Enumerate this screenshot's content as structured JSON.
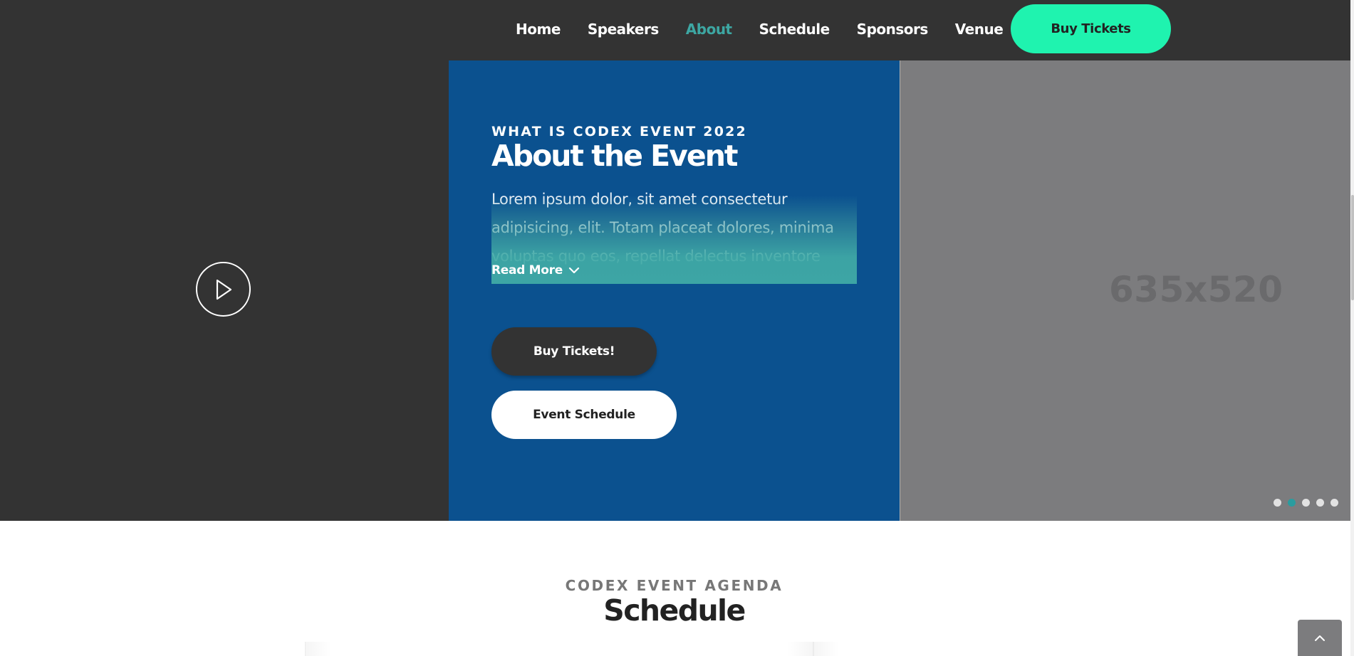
{
  "nav": {
    "items": [
      {
        "label": "Home",
        "active": false
      },
      {
        "label": "Speakers",
        "active": false
      },
      {
        "label": "About",
        "active": true
      },
      {
        "label": "Schedule",
        "active": false
      },
      {
        "label": "Sponsors",
        "active": false
      },
      {
        "label": "Venue",
        "active": false
      }
    ],
    "cta_label": "Buy Tickets"
  },
  "hero": {
    "play_icon": "play-icon",
    "eyebrow": "WHAT IS CODEX EVENT 2022",
    "title": "About the Event",
    "body": "Lorem ipsum dolor, sit amet consectetur adipisicing, elit. Totam placeat dolores, minima voluptas quo eos, repellat delectus inventore",
    "read_more_label": "Read More",
    "read_more_icon": "chevron-down-icon",
    "primary_button_label": "Buy Tickets!",
    "secondary_button_label": "Event Schedule",
    "image_placeholder_label": "635x520",
    "carousel": {
      "count": 5,
      "active_index": 1
    }
  },
  "schedule": {
    "eyebrow": "CODEX EVENT AGENDA",
    "title": "Schedule"
  },
  "scroll_top_icon": "chevron-up-icon",
  "colors": {
    "dark": "#333333",
    "accent_nav": "#3da7a3",
    "cta_green": "#1ff3af",
    "panel_blue": "#0b518f",
    "placeholder_gray": "#7c7c7e",
    "dot_active": "#2a9c9f"
  }
}
